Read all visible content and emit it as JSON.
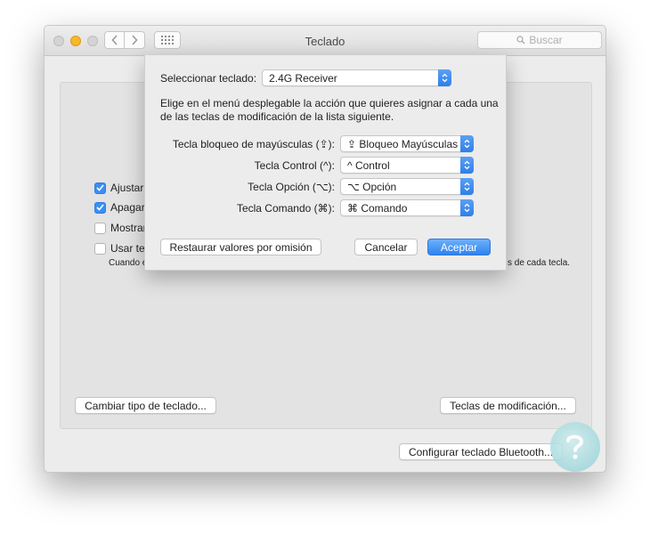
{
  "window": {
    "title": "Teclado",
    "search_placeholder": "Buscar"
  },
  "panel": {
    "checkboxes": [
      {
        "label": "Ajustar b",
        "checked": true
      },
      {
        "label": "Apagar l",
        "checked": true
      },
      {
        "label": "Mostrar",
        "checked": false
      },
      {
        "label": "Usar tec",
        "checked": false
      }
    ],
    "sub_note_left": "Cuando e",
    "sub_note_right": "s de cada tecla.",
    "change_keyboard_type_button": "Cambiar tipo de teclado...",
    "modifier_keys_button": "Teclas de modificación...",
    "bluetooth_button": "Configurar teclado Bluetooth..."
  },
  "sheet": {
    "select_label": "Seleccionar teclado:",
    "select_value": "2.4G Receiver",
    "description": "Elige en el menú desplegable la acción que quieres asignar a cada una de las teclas de modificación de la lista siguiente.",
    "modifiers": [
      {
        "label": "Tecla bloqueo de mayúsculas (⇪):",
        "value": "⇪ Bloqueo Mayúsculas"
      },
      {
        "label": "Tecla Control (^):",
        "value": "^ Control"
      },
      {
        "label": "Tecla Opción (⌥):",
        "value": "⌥ Opción"
      },
      {
        "label": "Tecla Comando (⌘):",
        "value": "⌘ Comando"
      }
    ],
    "restore_button": "Restaurar valores por omisión",
    "cancel_button": "Cancelar",
    "accept_button": "Aceptar"
  },
  "colors": {
    "accent": "#3b8ef3",
    "traffic_minimize": "#f7b82c"
  },
  "icons": {
    "back": "chevron-left-icon",
    "forward": "chevron-right-icon",
    "grid": "grid-icon",
    "search": "search-icon",
    "popup_arrows": "up-down-chevron-icon"
  }
}
